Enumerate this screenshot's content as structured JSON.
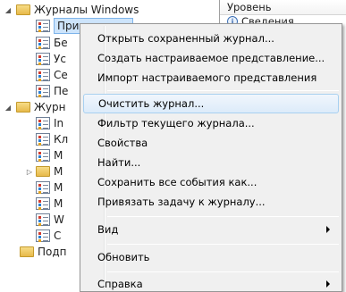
{
  "tree": {
    "windows_logs": "Журналы Windows",
    "app_item": "Приложение",
    "partial_items": [
      "Бе",
      "Ус",
      "Се",
      "Пе"
    ],
    "services_logs": "Журн",
    "services_items": [
      "In",
      "Кл",
      "М",
      "М",
      "М",
      "М",
      "W",
      "С"
    ],
    "subscriptions": "Подп"
  },
  "right_pane": {
    "column_header": "Уровень",
    "first_value": "Сведения"
  },
  "context_menu": {
    "items": [
      "Открыть сохраненный журнал...",
      "Создать настраиваемое представление...",
      "Импорт настраиваемого представления",
      "Очистить журнал...",
      "Фильтр текущего журнала...",
      "Свойства",
      "Найти...",
      "Сохранить все события как...",
      "Привязать задачу к журналу...",
      "Вид",
      "Обновить",
      "Справка"
    ],
    "highlighted": "Очистить журнал..."
  }
}
